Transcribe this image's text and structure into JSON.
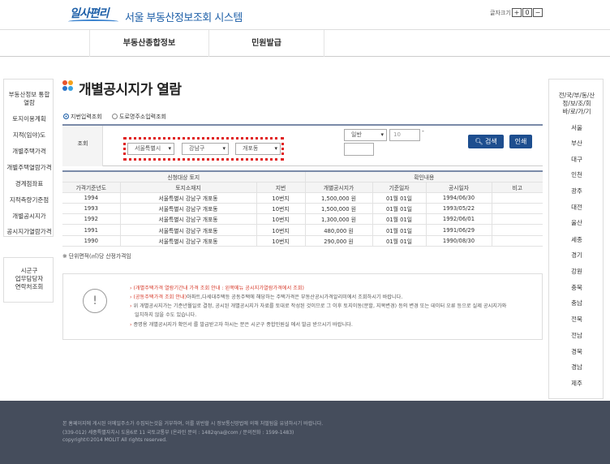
{
  "header": {
    "logo": "일사편리",
    "system_title": "서울 부동산정보조회 시스템",
    "font_size_label": "글자크기",
    "font_size_buttons": [
      "+",
      "0",
      "−"
    ]
  },
  "nav": {
    "items": [
      "부동산종합정보",
      "민원발급"
    ]
  },
  "left_sidebar": {
    "items": [
      "부동산정보 통합",
      "열람",
      "토지이용계획",
      "지적(임야)도",
      "개별주택가격",
      "개별주택열람가격",
      "경계점좌표",
      "지적측량기준점",
      "개별공시지가",
      "공시지가열람가격"
    ],
    "contact": [
      "시군구",
      "업무담당자",
      "연락처조회"
    ]
  },
  "right_sidebar": {
    "header": [
      "전/국/부/동/산",
      "정/보/조/회",
      "바/로/가/기"
    ],
    "items": [
      "서울",
      "부산",
      "대구",
      "인천",
      "광주",
      "대전",
      "울산",
      "세종",
      "경기",
      "강원",
      "충북",
      "충남",
      "전북",
      "전남",
      "경북",
      "경남",
      "제주"
    ]
  },
  "main": {
    "title": "개별공시지가 열람",
    "title_colors": [
      "#e8532b",
      "#f4a11c",
      "#2b74c8",
      "#3aa3e0"
    ],
    "radios": [
      {
        "label": "지번입력조회",
        "checked": true
      },
      {
        "label": "도로명주소입력조회",
        "checked": false
      }
    ],
    "search": {
      "label": "조회",
      "sido": "서울특별시",
      "sigungu": "강남구",
      "dong": "개포동",
      "period": "일반",
      "number": "10",
      "dash": "-",
      "search_button": "검색",
      "print_button": "인쇄",
      "highlight_color": "#e02020"
    },
    "table": {
      "group_headers": [
        "신청대상 토지",
        "확인내용"
      ],
      "columns": [
        "가격기준년도",
        "토지소재지",
        "지번",
        "개별공시지가",
        "기준일자",
        "공시일자",
        "비고"
      ],
      "rows": [
        [
          "1994",
          "서울특별시 강남구 개포동",
          "10번지",
          "1,500,000 원",
          "01월 01일",
          "1994/06/30",
          ""
        ],
        [
          "1993",
          "서울특별시 강남구 개포동",
          "10번지",
          "1,500,000 원",
          "01월 01일",
          "1993/05/22",
          ""
        ],
        [
          "1992",
          "서울특별시 강남구 개포동",
          "10번지",
          "1,300,000 원",
          "01월 01일",
          "1992/06/01",
          ""
        ],
        [
          "1991",
          "서울특별시 강남구 개포동",
          "10번지",
          "480,000 원",
          "01월 01일",
          "1991/06/29",
          ""
        ],
        [
          "1990",
          "서울특별시 강남구 개포동",
          "10번지",
          "290,000 원",
          "01월 01일",
          "1990/08/30",
          ""
        ]
      ]
    },
    "note": "※ 단위면적(㎡)당 산정가격임",
    "info": {
      "icon": "!",
      "lines": [
        {
          "red": "(개별주택가격 열람기간내 가격 조회 안내 : 왼쪽메뉴 공시지가열람가격에서 조회)",
          "text": ""
        },
        {
          "red": "(공동주택가격 조회 안내)",
          "text": "아파트,다세대주택등 공동주택에 해당하는 주택가격은 부동산공시가격알리미에서 조회하시기 바랍니다."
        },
        {
          "red": "",
          "text": "위 개별공시지가는 기준년월일로 결정, 공시된 개별공시지가 자료를 토대로 작성된 것이므로 그 이후 토지이동(분할, 지목변경) 등의 변경 또는 데이터 오류 등으로 실제 공시지가와"
        },
        {
          "red": "",
          "text": "일치하지 않을 수도 있습니다."
        },
        {
          "red": "",
          "text": "증명용 개별공시지가 확인서 를 발급받고자 하시는 분은 시군구 종합민원실 에서 발급 받으시기 바랍니다."
        }
      ]
    }
  },
  "footer": {
    "lines": [
      "본 홈페이지에 게시된 이메일주소가 수집되는것을 거부하며, 이를 위반할 시 정보통신망법에 의해 처벌됨을 유념하시기 바랍니다.",
      "(339-012) 세종특별자치시 도움6로 11 국토교통부 (온라인 문의 : 1482qna@com / 문의전화 : 1599-1483)",
      "copyright©2014 MOLIT All rights reserved."
    ]
  }
}
